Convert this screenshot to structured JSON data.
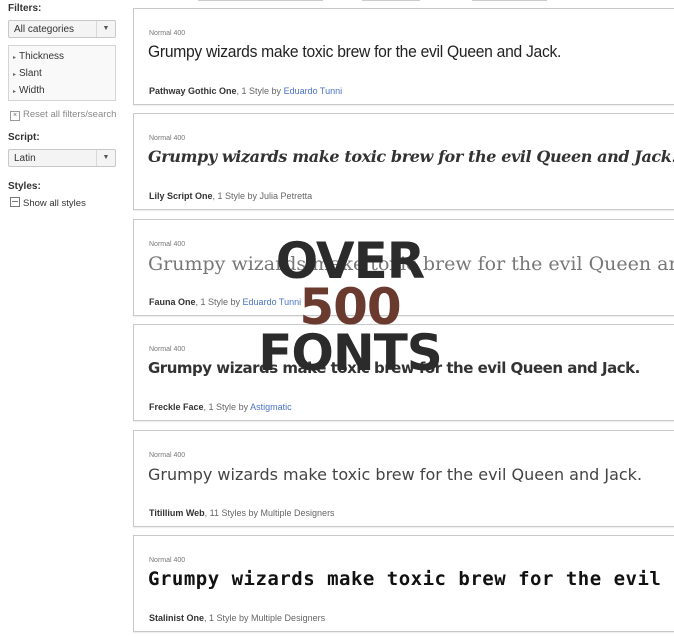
{
  "sidebar": {
    "filters_label": "Filters:",
    "category_select": "All categories",
    "filter_items": [
      "Thickness",
      "Slant",
      "Width"
    ],
    "reset_label": "Reset all filters/search",
    "script_label": "Script:",
    "script_select": "Latin",
    "styles_label": "Styles:",
    "show_styles_label": "Show all styles"
  },
  "fonts": [
    {
      "style": "Normal 400",
      "sample": "Grumpy wizards make toxic brew for the evil Queen and Jack.",
      "name": "Pathway Gothic One",
      "styles": ", 1 Style by ",
      "designer": "Eduardo Tunni",
      "designer_link": true
    },
    {
      "style": "Normal 400",
      "sample": "Grumpy wizards make toxic brew for the evil Queen and Jack.",
      "name": "Lily Script One",
      "styles": ", 1 Style by ",
      "designer": "Julia Petretta",
      "designer_link": false
    },
    {
      "style": "Normal 400",
      "sample": "Grumpy wizards make toxic brew for the evil Queen and Jack.",
      "name": "Fauna One",
      "styles": ", 1 Style by ",
      "designer": "Eduardo Tunni",
      "designer_link": true
    },
    {
      "style": "Normal 400",
      "sample": "Grumpy wizards make toxic brew for the evil Queen and Jack.",
      "name": "Freckle Face",
      "styles": ", 1 Style by ",
      "designer": "Astigmatic",
      "designer_link": true
    },
    {
      "style": "Normal 400",
      "sample": "Grumpy wizards make toxic brew for the evil Queen and Jack.",
      "name": "Titillium Web",
      "styles": ", 11 Styles by ",
      "designer": "Multiple Designers",
      "designer_link": false
    },
    {
      "style": "Normal 400",
      "sample": "Grumpy wizards make toxic brew for the evil Queen and Jack.",
      "name": "Stalinist One",
      "styles": ", 1 Style by ",
      "designer": "Multiple Designers",
      "designer_link": false
    }
  ],
  "overlay": {
    "line1": "OVER",
    "line2": "500",
    "line3": "FONTS"
  },
  "colors": {
    "link": "#4a72c4",
    "overlay_dark": "#2b2b2b",
    "overlay_accent": "#6b3a2e"
  }
}
